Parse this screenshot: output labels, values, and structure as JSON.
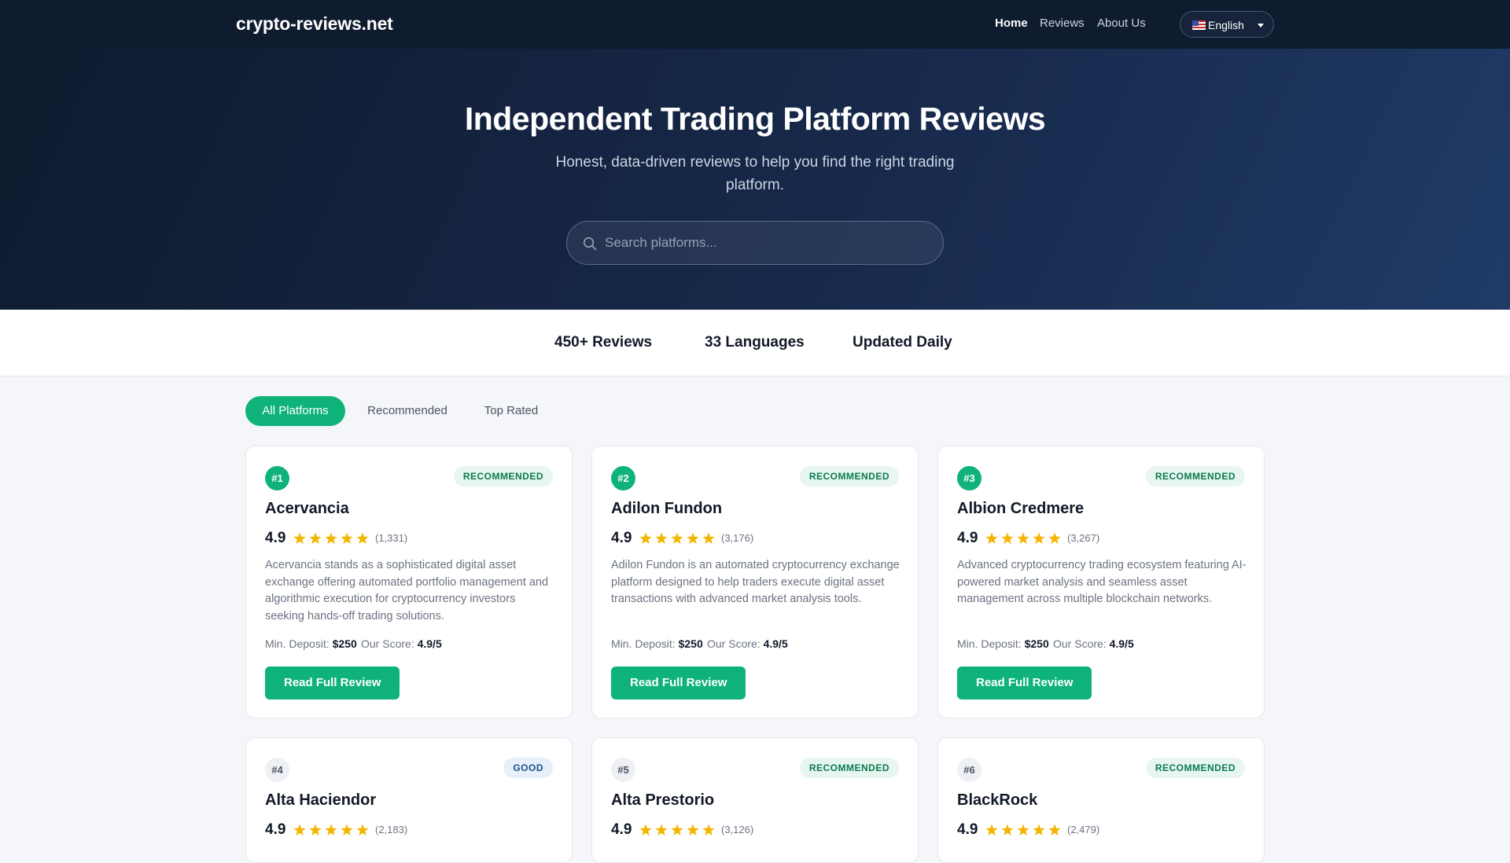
{
  "header": {
    "brand": "crypto-reviews.net",
    "nav": [
      "Home",
      "Reviews",
      "About Us"
    ],
    "language": {
      "label": "English",
      "icon": "us-flag-icon"
    }
  },
  "hero": {
    "title": "Independent Trading Platform Reviews",
    "subtitle": "Honest, data-driven reviews to help you find the right trading platform.",
    "search_placeholder": "Search platforms...",
    "search_icon": "search-icon"
  },
  "stats": [
    "450+ Reviews",
    "33 Languages",
    "Updated Daily"
  ],
  "filters": {
    "tabs": [
      "All Platforms",
      "Recommended",
      "Top Rated"
    ],
    "active": "All Platforms"
  },
  "colors": {
    "accent": "#0fb37a",
    "header_bg": "#0f1b2e",
    "star": "#f5b400",
    "badge_recommended_text": "#0a7a51",
    "badge_good_text": "#1d4e89"
  },
  "labels": {
    "min_deposit": "Min. Deposit:",
    "our_score": "Our Score:",
    "cta": "Read Full Review"
  },
  "platforms": [
    {
      "rank": "#1",
      "badge": "RECOMMENDED",
      "name": "Acervancia",
      "rating": "4.9",
      "stars": 5,
      "reviews": "(1,331)",
      "description": "Acervancia stands as a sophisticated digital asset exchange offering automated portfolio management and algorithmic execution for cryptocurrency investors seeking hands-off trading solutions.",
      "min_deposit": "$250",
      "score": "4.9/5"
    },
    {
      "rank": "#2",
      "badge": "RECOMMENDED",
      "name": "Adilon Fundon",
      "rating": "4.9",
      "stars": 5,
      "reviews": "(3,176)",
      "description": "Adilon Fundon is an automated cryptocurrency exchange platform designed to help traders execute digital asset transactions with advanced market analysis tools.",
      "min_deposit": "$250",
      "score": "4.9/5"
    },
    {
      "rank": "#3",
      "badge": "RECOMMENDED",
      "name": "Albion Credmere",
      "rating": "4.9",
      "stars": 5,
      "reviews": "(3,267)",
      "description": "Advanced cryptocurrency trading ecosystem featuring AI-powered market analysis and seamless asset management across multiple blockchain networks.",
      "min_deposit": "$250",
      "score": "4.9/5"
    },
    {
      "rank": "#4",
      "badge": "GOOD",
      "name": "Alta Haciendor",
      "rating": "4.9",
      "stars": 5,
      "reviews": "(2,183)"
    },
    {
      "rank": "#5",
      "badge": "RECOMMENDED",
      "name": "Alta Prestorio",
      "rating": "4.9",
      "stars": 5,
      "reviews": "(3,126)"
    },
    {
      "rank": "#6",
      "badge": "RECOMMENDED",
      "name": "BlackRock",
      "rating": "4.9",
      "stars": 5,
      "reviews": "(2,479)"
    }
  ]
}
